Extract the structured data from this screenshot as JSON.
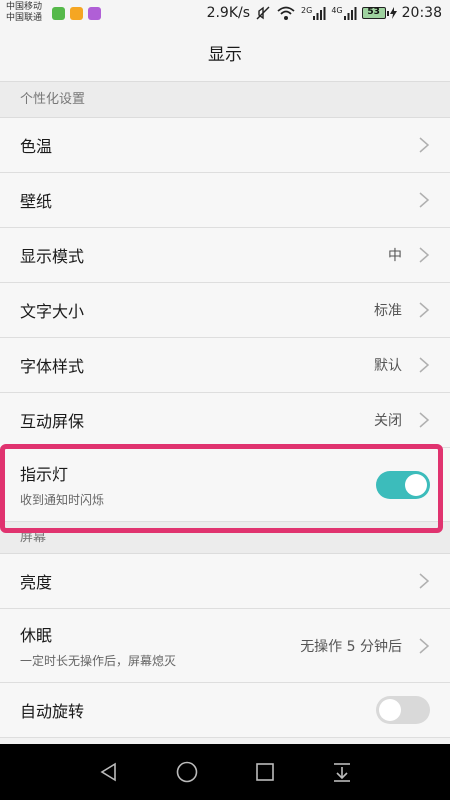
{
  "status_bar": {
    "carrier1": "中国移动",
    "carrier2": "中国联通",
    "speed": "2.9K/s",
    "net1": "2G",
    "net2": "4G",
    "battery": "53",
    "time": "20:38",
    "app_icon_colors": [
      "#55b94a",
      "#f5a623",
      "#b05fd6"
    ]
  },
  "title": "显示",
  "sections": {
    "personalization": {
      "header": "个性化设置",
      "color_temp": "色温",
      "wallpaper": "壁纸",
      "display_mode": {
        "label": "显示模式",
        "value": "中"
      },
      "text_size": {
        "label": "文字大小",
        "value": "标准"
      },
      "font_style": {
        "label": "字体样式",
        "value": "默认"
      },
      "screensaver": {
        "label": "互动屏保",
        "value": "关闭"
      },
      "indicator": {
        "label": "指示灯",
        "sub": "收到通知时闪烁",
        "enabled": true
      }
    },
    "screen": {
      "header": "屏幕",
      "brightness": "亮度",
      "sleep": {
        "label": "休眠",
        "sub": "一定时长无操作后，屏幕熄灭",
        "value": "无操作 5 分钟后"
      },
      "auto_rotate": {
        "label": "自动旋转",
        "enabled": false
      }
    }
  },
  "colors": {
    "toggle_on": "#3cbcbb",
    "highlight": "#e0336f"
  }
}
